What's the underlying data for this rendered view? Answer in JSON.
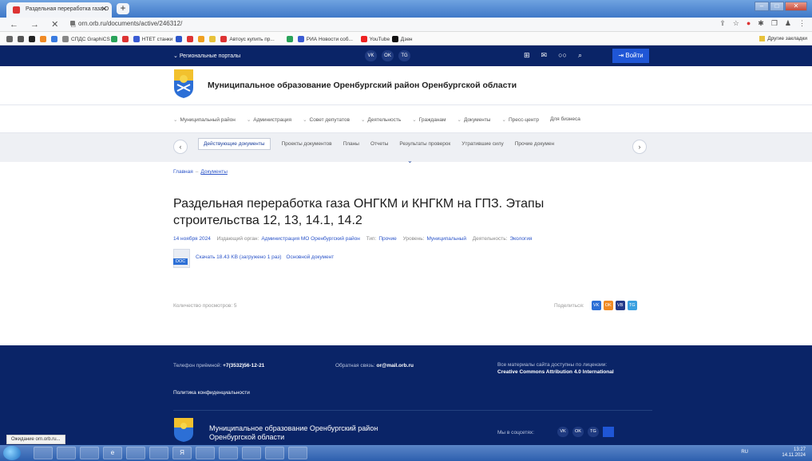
{
  "browser": {
    "tab_title": "Раздельная переработка газа О",
    "tab_close": "✕",
    "new_tab": "+",
    "url": "orn.orb.ru/documents/active/246312/",
    "nav_glyphs": "← → ✕ ⌂",
    "bookmarks": [
      {
        "label": "",
        "color": "#666"
      },
      {
        "label": "",
        "color": "#555"
      },
      {
        "label": "",
        "color": "#222"
      },
      {
        "label": "",
        "color": "#f08a24"
      },
      {
        "label": "",
        "color": "#3a7be0"
      },
      {
        "label": "СПДС GraphiCS",
        "color": "#888"
      },
      {
        "label": "",
        "color": "#2aa35a"
      },
      {
        "label": "",
        "color": "#d33"
      },
      {
        "label": "НТЕТ станки",
        "color": "#3a5bd3"
      },
      {
        "label": "",
        "color": "#2c55c9"
      },
      {
        "label": "",
        "color": "#d33"
      },
      {
        "label": "",
        "color": "#f0a020"
      },
      {
        "label": "",
        "color": "#e8c23a"
      },
      {
        "label": "Автоус купить пр...",
        "color": "#d33"
      },
      {
        "label": "",
        "color": "#2aa35a"
      },
      {
        "label": "РИА Новости coб...",
        "color": "#3a5bd3"
      },
      {
        "label": "YouTube",
        "color": "#e22"
      },
      {
        "label": "Дзен",
        "color": "#111"
      }
    ],
    "other_bookmarks": "Другие закладки"
  },
  "topnav": {
    "region_label": "Региональные порталы",
    "socials": [
      "VK",
      "OK",
      "TG"
    ],
    "tools": [
      "⊞",
      "✉",
      "○○",
      "⌕"
    ],
    "login": "Войти"
  },
  "header": {
    "site_title": "Муниципальное образование Оренбургский район Оренбургской области"
  },
  "mainmenu": [
    "Муниципальный район",
    "Администрация",
    "Совет депутатов",
    "Деятельность",
    "Гражданам",
    "Документы",
    "Пресс-центр",
    "Для бизнеса"
  ],
  "subtabs": [
    "Действующие документы",
    "Проекты документов",
    "Планы",
    "Отчеты",
    "Результаты проверок",
    "Утратившие силу",
    "Прочие докумен"
  ],
  "breadcrumbs": {
    "home": "Главная",
    "separator": "–",
    "current": "Документы"
  },
  "document": {
    "title": "Раздельная переработка газа ОНГКМ и КНГКМ на ГПЗ. Этапы строительства 12, 13, 14.1, 14.2",
    "date": "14 ноября 2024",
    "issuer_label": "Издающий орган:",
    "issuer": "Администрация МО Оренбургский район",
    "type_label": "Тип:",
    "type": "Прочие",
    "level_label": "Уровень:",
    "level": "Муниципальный",
    "activity_label": "Деятельность:",
    "activity": "Экология",
    "file_badge": "DOC",
    "download_text": "Скачать 18.43 KB (загружено 1 раз)",
    "main_doc": "Основной документ",
    "views": "Количество просмотров: 5",
    "share_label": "Поделиться:",
    "share_icons": [
      {
        "label": "VK",
        "color": "#2c6fd6"
      },
      {
        "label": "OK",
        "color": "#f08a24"
      },
      {
        "label": "VB",
        "color": "#243a8a"
      },
      {
        "label": "TG",
        "color": "#3aa0e0"
      }
    ]
  },
  "footer": {
    "phone_label": "Телефон приёмной:",
    "phone": "+7(3532)56-12-21",
    "mail_label": "Обратная связь:",
    "mail": "or@mail.orb.ru",
    "license_line1": "Все материалы сайта доступны по лицензии:",
    "license_line2": "Creative Commons Attribution 4.0 International",
    "privacy": "Политика конфиденциальности",
    "title_line1": "Муниципальное образование Оренбургский район",
    "title_line2": "Оренбургской области",
    "social_label": "Мы в соцсетях:",
    "socials": [
      "VK",
      "OK",
      "TG"
    ]
  },
  "status_tip": "Ожидание orn.orb.ru...",
  "taskbar": {
    "apps": [
      "",
      "",
      "",
      "e",
      "",
      "",
      "Я",
      "",
      "",
      "",
      "",
      ""
    ],
    "lang": "RU",
    "time": "13:27",
    "date": "14.11.2024"
  }
}
